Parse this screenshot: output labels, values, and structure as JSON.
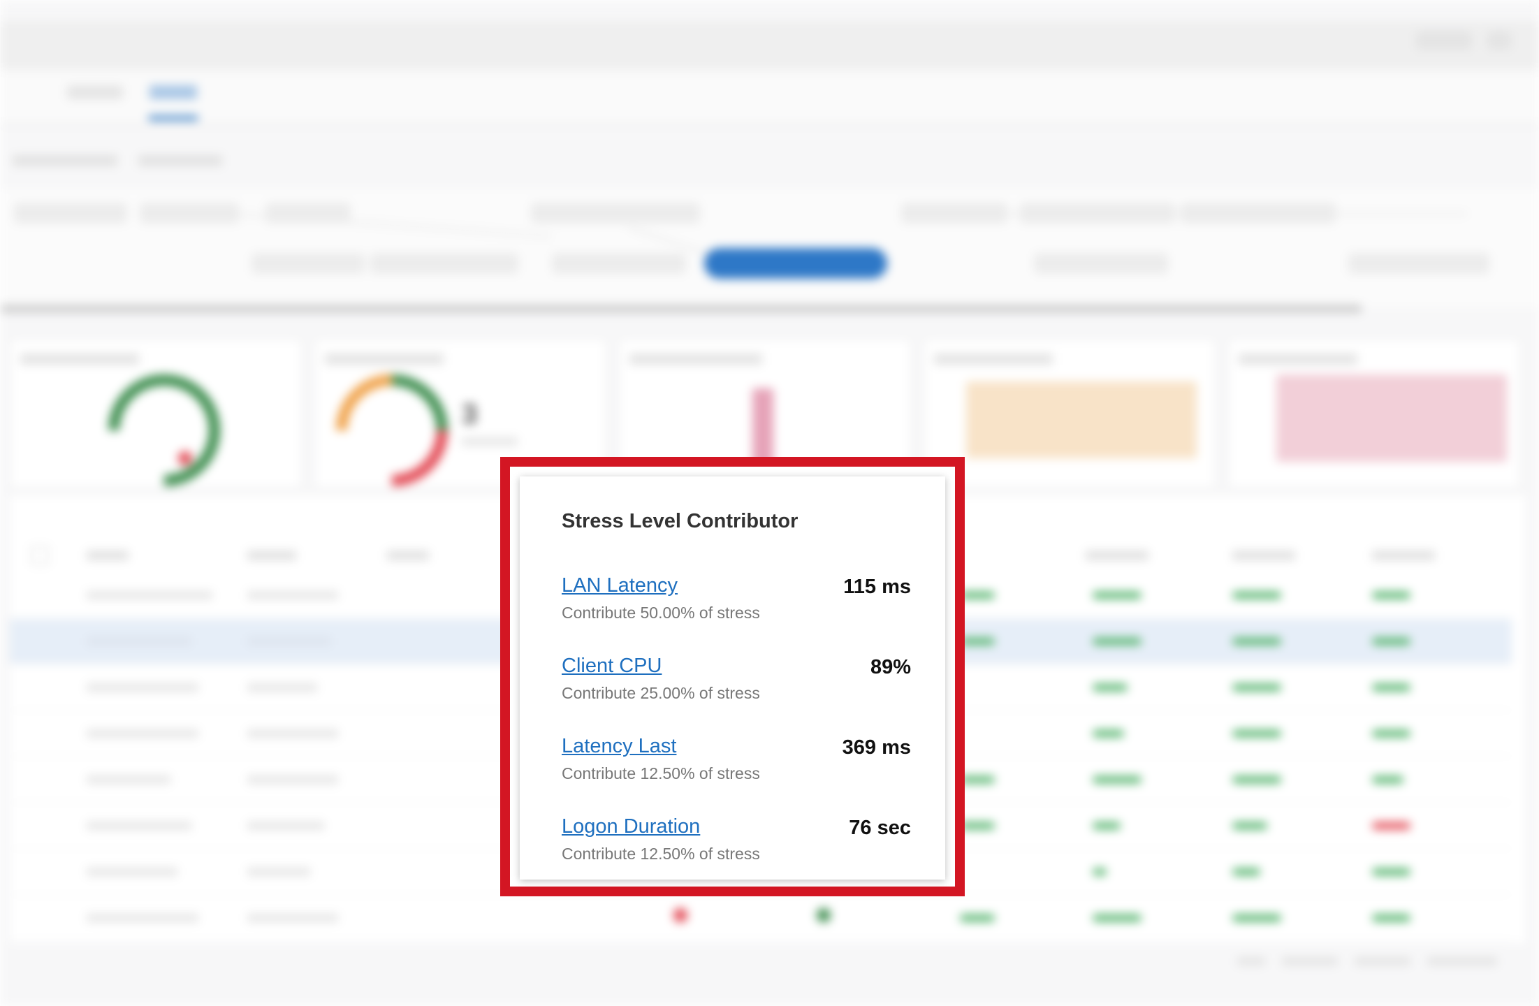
{
  "popup": {
    "title": "Stress Level Contributor",
    "items": [
      {
        "name": "LAN Latency",
        "value": "115 ms",
        "description": "Contribute 50.00% of stress"
      },
      {
        "name": "Client CPU",
        "value": "89%",
        "description": "Contribute 25.00% of stress"
      },
      {
        "name": "Latency Last",
        "value": "369 ms",
        "description": "Contribute 12.50% of stress"
      },
      {
        "name": "Logon Duration",
        "value": "76 sec",
        "description": "Contribute 12.50% of stress"
      }
    ]
  },
  "colors": {
    "highlight_border": "#d31623",
    "link": "#1e6fbf",
    "value_text": "#111111",
    "description_text": "#777777"
  }
}
